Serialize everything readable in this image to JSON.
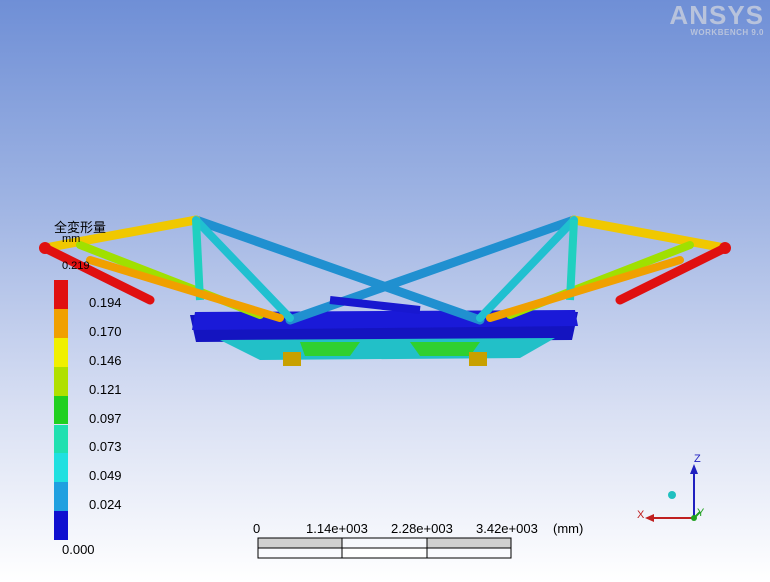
{
  "logo": {
    "brand": "ANSYS",
    "subtitle": "WORKBENCH 9.0"
  },
  "legend": {
    "title": "全変形量",
    "unit": "mm",
    "max_label": "0.219",
    "min_label": "0.000",
    "levels": [
      {
        "label": "0.194",
        "color": "#e01010"
      },
      {
        "label": "0.170",
        "color": "#f0a000"
      },
      {
        "label": "0.146",
        "color": "#f0f000"
      },
      {
        "label": "0.121",
        "color": "#b0e000"
      },
      {
        "label": "0.097",
        "color": "#20d020"
      },
      {
        "label": "0.073",
        "color": "#20e0b0"
      },
      {
        "label": "0.049",
        "color": "#20e0e0"
      },
      {
        "label": "0.024",
        "color": "#20a0e0"
      },
      {
        "label": "",
        "color": "#1010d0"
      }
    ]
  },
  "scale_bar": {
    "ticks": [
      "0",
      "1.14e+003",
      "2.28e+003",
      "3.42e+003"
    ],
    "unit": "(mm)"
  },
  "triad": {
    "x": "X",
    "y": "Y",
    "z": "Z"
  }
}
